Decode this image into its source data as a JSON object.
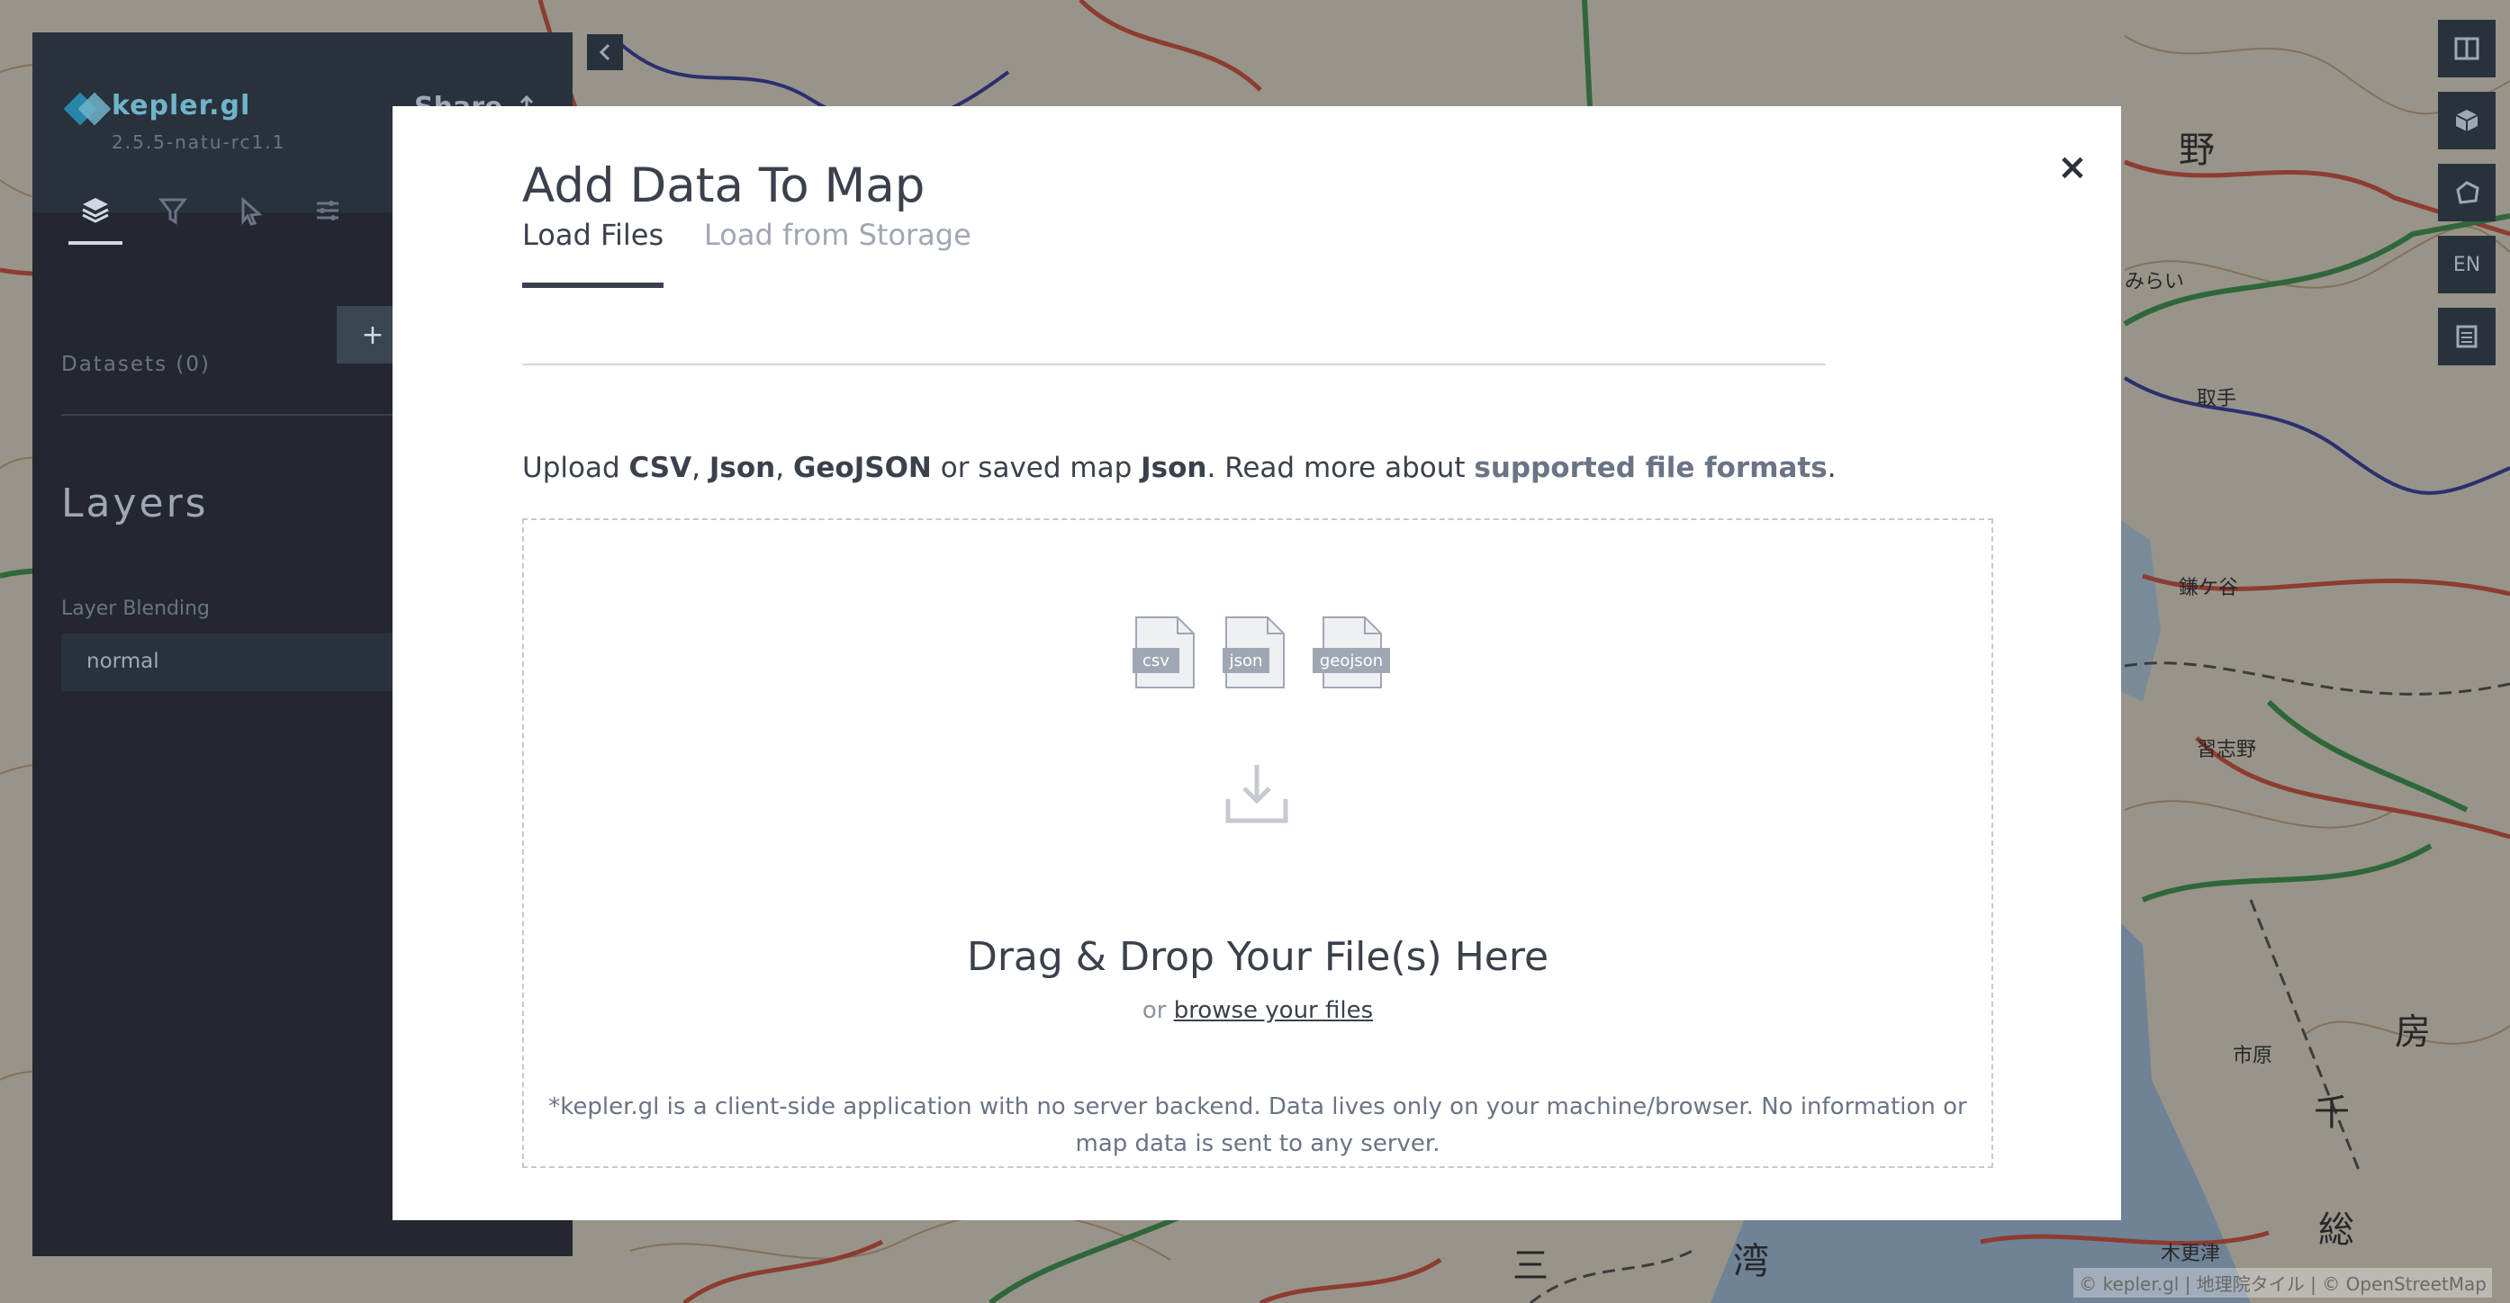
{
  "app": {
    "name": "kepler.gl",
    "version": "2.5.5-natu-rc1.1",
    "share_label": "Share"
  },
  "side_panel": {
    "tabs": [
      {
        "name": "layer",
        "icon": "layers-icon",
        "active": true
      },
      {
        "name": "filter",
        "icon": "filter-icon",
        "active": false
      },
      {
        "name": "interaction",
        "icon": "cursor-icon",
        "active": false
      },
      {
        "name": "map",
        "icon": "sliders-icon",
        "active": false
      },
      {
        "name": "extra",
        "icon": "pen-icon",
        "active": false
      }
    ],
    "datasets_label": "Datasets (0)",
    "add_data_label": "+",
    "layers_title": "Layers",
    "layer_blending_label": "Layer Blending",
    "layer_blending_value": "normal"
  },
  "map_controls": {
    "items": [
      "split-map-icon",
      "3d-cube-icon",
      "draw-polygon-icon",
      "EN",
      "legend-icon"
    ],
    "locale_label": "EN"
  },
  "attribution": "© kepler.gl | 地理院タイル | © OpenStreetMap",
  "modal": {
    "title": "Add Data To Map",
    "close_label": "×",
    "tabs": [
      "Load Files",
      "Load from Storage"
    ],
    "upload_prefix": "Upload ",
    "formats": [
      "CSV",
      "Json",
      "GeoJSON"
    ],
    "saved_map_text": " or saved map ",
    "saved_map_format": "Json",
    "read_more": ". Read more about ",
    "supported_link": "supported file formats",
    "period": ".",
    "file_icons": [
      "csv",
      "json",
      "geojson"
    ],
    "drop_title": "Drag & Drop Your File(s) Here",
    "drop_or": "or ",
    "browse_link": "browse your files",
    "disclaimer": "*kepler.gl is a client-side application with no server backend. Data lives only on your machine/browser. No information or map data is sent to any server."
  },
  "colors": {
    "panel_bg": "#242730",
    "accent": "#6fb4c9",
    "modal_bg": "#ffffff",
    "text_dark": "#3a414c"
  }
}
